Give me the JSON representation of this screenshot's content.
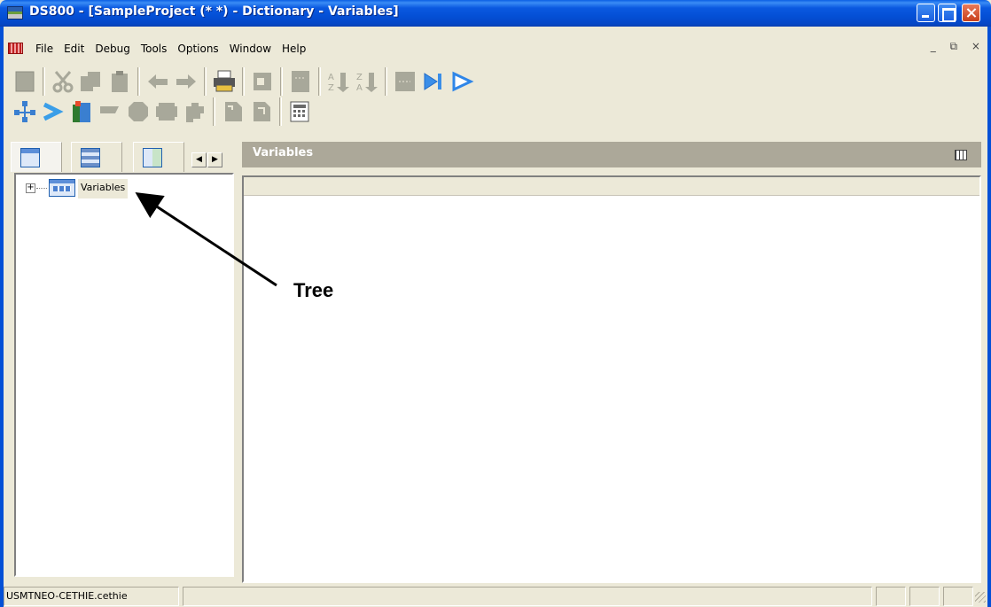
{
  "window": {
    "title": "DS800 - [SampleProject (*  *) - Dictionary - Variables]"
  },
  "menu": {
    "items": [
      "File",
      "Edit",
      "Debug",
      "Tools",
      "Options",
      "Window",
      "Help"
    ],
    "mdi_controls": "_ ⧉ ×"
  },
  "toolbars": {
    "row1": [
      "save-icon",
      "cut-icon",
      "copy-icon",
      "paste-icon",
      "undo-icon",
      "redo-icon",
      "print-icon",
      "find-icon",
      "columns-icon",
      "sort-asc-icon",
      "sort-desc-icon",
      "field-icon",
      "step-into-icon",
      "run-icon"
    ],
    "row2": [
      "network-icon",
      "link-icon",
      "book-icon",
      "flag-icon",
      "stop-icon",
      "box-icon",
      "puzzle-icon",
      "file-new-icon",
      "file-open-icon",
      "calculator-icon"
    ]
  },
  "left_panel": {
    "tabs": [
      "variables-tab-icon",
      "hardware-tab-icon",
      "program-tab-icon"
    ],
    "tree": {
      "nodes": [
        {
          "label": "Variables",
          "expanded": false
        }
      ]
    }
  },
  "annotation": {
    "label": "Tree"
  },
  "right_panel": {
    "title": "Variables"
  },
  "statusbar": {
    "user": "USMTNEO-CETHIE.cethie"
  },
  "colors": {
    "titlebar": "#0450d6",
    "panel_header": "#aca899",
    "chrome": "#ece9d8"
  }
}
